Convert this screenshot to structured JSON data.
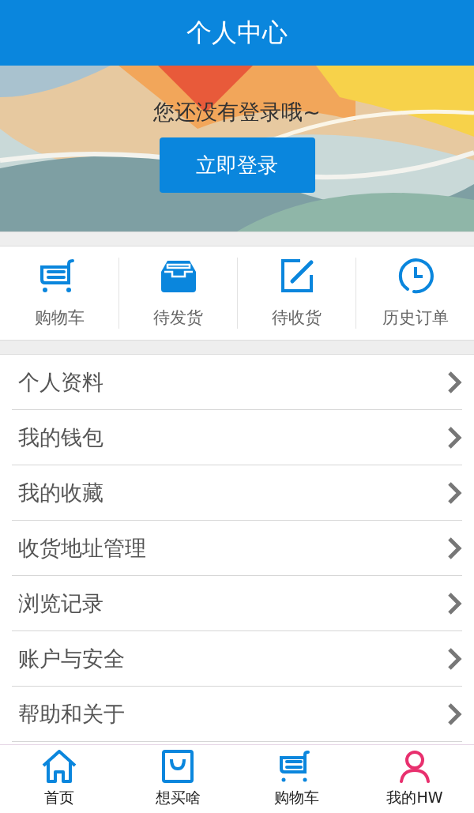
{
  "header": {
    "title": "个人中心"
  },
  "banner": {
    "kind": "picture",
    "message": "您还没有登录哦~",
    "login_button": "立即登录"
  },
  "quick_actions": [
    {
      "kind": "cart",
      "label": "购物车"
    },
    {
      "kind": "box",
      "label": "待发货"
    },
    {
      "kind": "edit",
      "label": "待收货"
    },
    {
      "kind": "clock",
      "label": "历史订单"
    }
  ],
  "menu": [
    "个人资料",
    "我的钱包",
    "我的收藏",
    "收货地址管理",
    "浏览记录",
    "账户与安全",
    "帮助和关于"
  ],
  "tab_bar": [
    {
      "kind": "home",
      "label": "首页",
      "selected": false
    },
    {
      "kind": "bag",
      "label": "想买啥",
      "selected": false
    },
    {
      "kind": "cart",
      "label": "购物车",
      "selected": false
    },
    {
      "kind": "user",
      "label": "我的HW",
      "selected": true
    }
  ]
}
